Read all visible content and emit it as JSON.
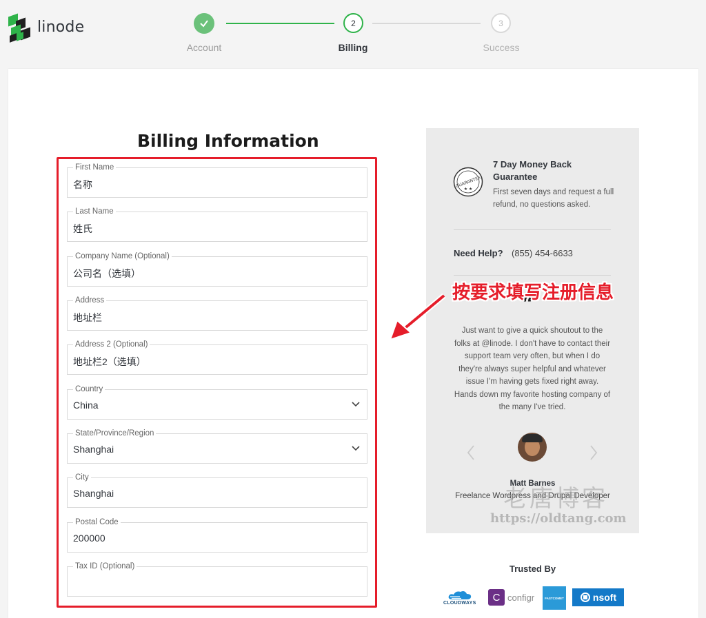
{
  "brand": {
    "logo_text": "linode"
  },
  "steps": [
    {
      "label": "Account",
      "state": "done"
    },
    {
      "label": "Billing",
      "number": "2",
      "state": "active"
    },
    {
      "label": "Success",
      "number": "3",
      "state": "pending"
    }
  ],
  "form": {
    "title": "Billing Information",
    "fields": [
      {
        "label": "First Name",
        "value": "名称"
      },
      {
        "label": "Last Name",
        "value": "姓氏"
      },
      {
        "label": "Company Name (Optional)",
        "value": "公司名（选填）"
      },
      {
        "label": "Address",
        "value": "地址栏"
      },
      {
        "label": "Address 2 (Optional)",
        "value": "地址栏2（选填）"
      },
      {
        "label": "Country",
        "value": "China"
      },
      {
        "label": "State/Province/Region",
        "value": "Shanghai"
      },
      {
        "label": "City",
        "value": "Shanghai"
      },
      {
        "label": "Postal Code",
        "value": "200000"
      },
      {
        "label": "Tax ID (Optional)",
        "value": ""
      }
    ]
  },
  "guarantee": {
    "seal_text": "GUARANTEE",
    "title": "7 Day Money Back Guarantee",
    "description": "First seven days and request a full refund, no questions asked."
  },
  "help": {
    "label": "Need Help?",
    "phone": "(855) 454-6633"
  },
  "annotation": "按要求填写注册信息",
  "testimonial": {
    "quote": "Just want to give a quick shoutout to the folks at @linode. I don't have to contact their support team very often, but when I do they're always super helpful and whatever issue I'm having gets fixed right away. Hands down my favorite hosting company of the many I've tried.",
    "name": "Matt Barnes",
    "role": "Freelance Wordpress and Drupal Developer"
  },
  "watermark": {
    "text": "老唐博客",
    "url": "https://oldtang.com"
  },
  "trusted": {
    "title": "Trusted By",
    "logos": [
      "CLOUDWAYS",
      "configr",
      "FASTCOMET",
      "nsoft"
    ]
  },
  "colors": {
    "accent_green": "#2fb34a",
    "annotation_red": "#e51d2a",
    "nsoft_blue": "#1479c8",
    "configr_purple": "#6b2f86"
  }
}
